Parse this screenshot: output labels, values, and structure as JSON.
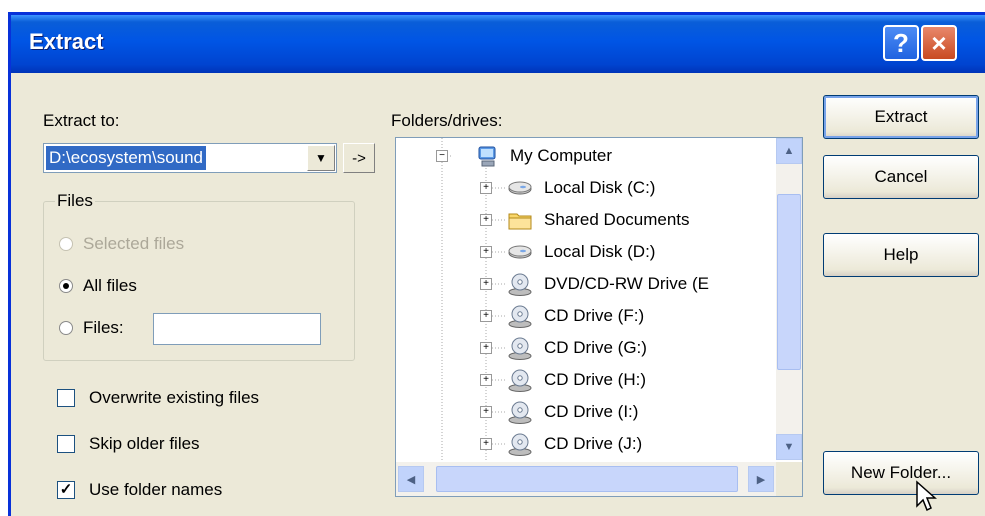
{
  "window": {
    "title": "Extract"
  },
  "titlebar": {
    "help_glyph": "?",
    "close_glyph": "×"
  },
  "extract_to": {
    "label": "Extract to:",
    "value": "D:\\ecosystem\\sound",
    "dropdown_glyph": "▼",
    "go_button": "->"
  },
  "files_group": {
    "title": "Files",
    "options": [
      "Selected files",
      "All files",
      "Files:"
    ],
    "selected": "All files",
    "disabled": "Selected files",
    "files_input_value": ""
  },
  "checkboxes": {
    "overwrite": {
      "label": "Overwrite existing files",
      "checked": false
    },
    "skip_older": {
      "label": "Skip older files",
      "checked": false
    },
    "use_folder_names": {
      "label": "Use folder names",
      "checked": true,
      "mark": "✓"
    }
  },
  "folders": {
    "label": "Folders/drives:",
    "root": "My Computer",
    "items": [
      {
        "label": "Local Disk (C:)",
        "icon": "hard-disk-icon"
      },
      {
        "label": "Shared Documents",
        "icon": "folder-icon"
      },
      {
        "label": "Local Disk (D:)",
        "icon": "hard-disk-icon"
      },
      {
        "label": "DVD/CD-RW Drive (E",
        "icon": "cd-drive-icon"
      },
      {
        "label": "CD Drive (F:)",
        "icon": "cd-drive-icon"
      },
      {
        "label": "CD Drive (G:)",
        "icon": "cd-drive-icon"
      },
      {
        "label": "CD Drive (H:)",
        "icon": "cd-drive-icon"
      },
      {
        "label": "CD Drive (I:)",
        "icon": "cd-drive-icon"
      },
      {
        "label": "CD Drive (J:)",
        "icon": "cd-drive-icon"
      }
    ],
    "collapse_glyph": "−",
    "expand_glyph": "+"
  },
  "buttons": {
    "extract": "Extract",
    "cancel": "Cancel",
    "help": "Help",
    "new_folder": "New Folder..."
  },
  "colors": {
    "titlebar": "#0055e5",
    "dialog_bg": "#ece9d8",
    "selection": "#316ac5"
  }
}
